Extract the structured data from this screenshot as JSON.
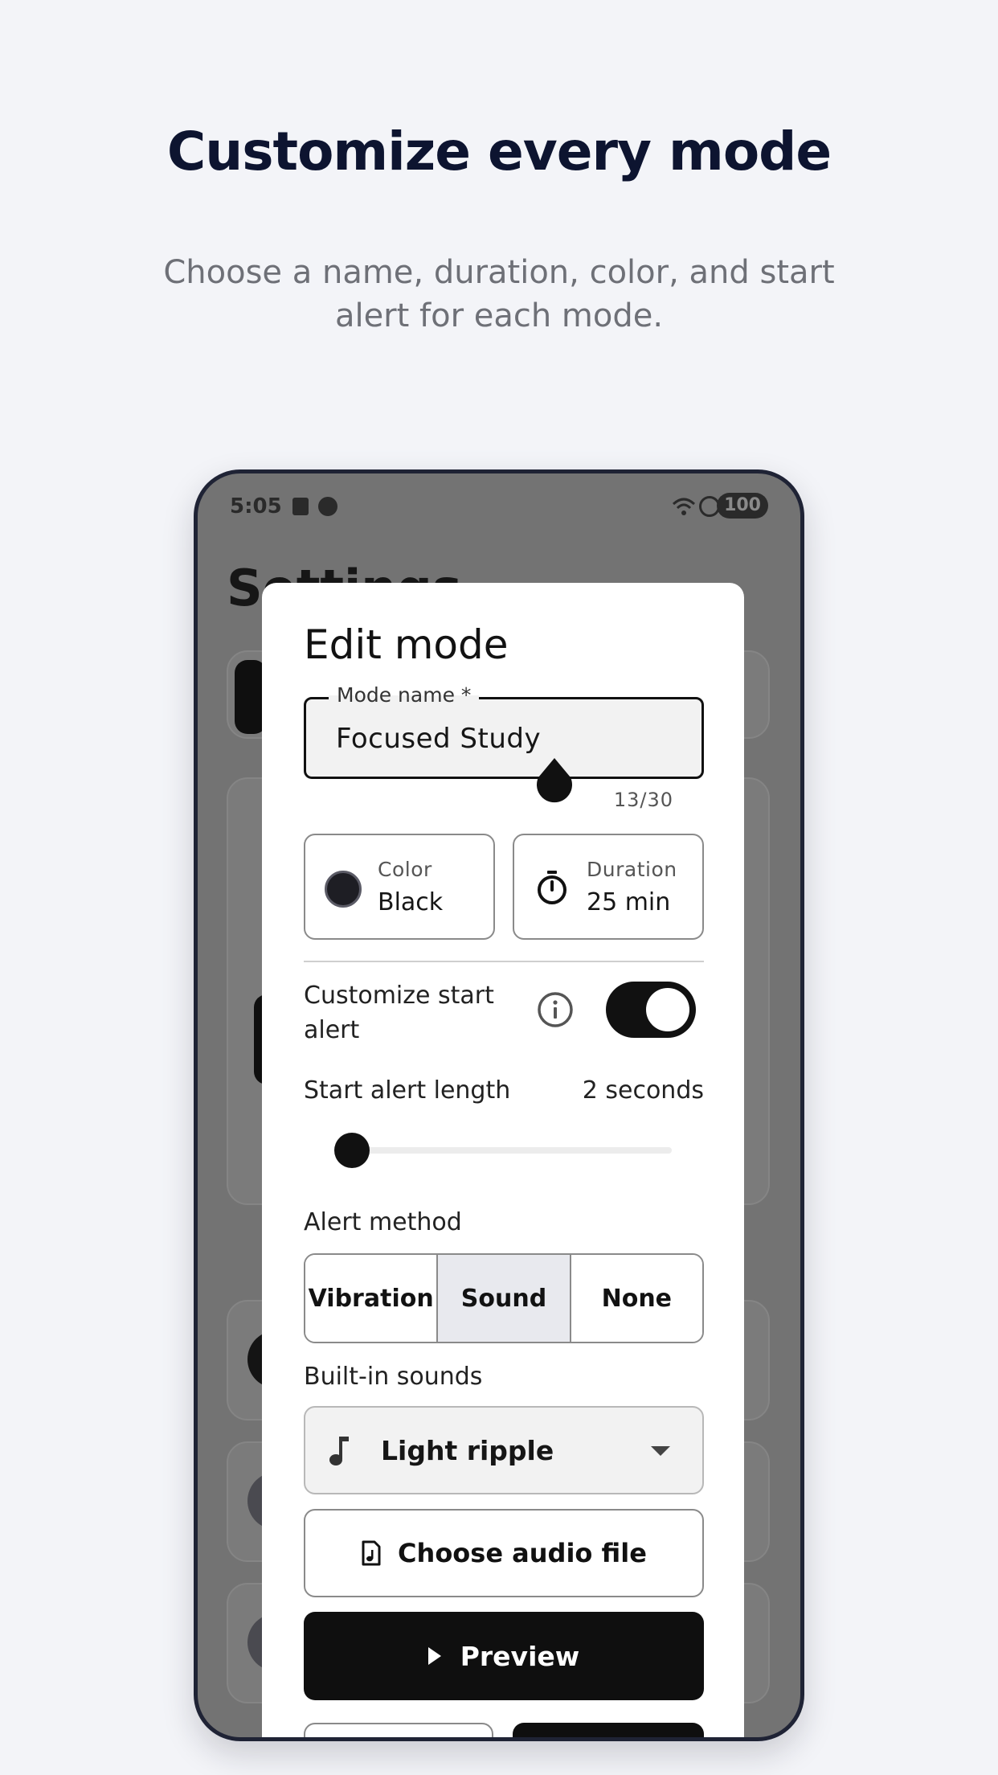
{
  "header": {
    "title": "Customize every mode",
    "subtitle": "Choose a name, duration, color, and start alert for each mode."
  },
  "status_bar": {
    "time": "5:05",
    "battery": "100"
  },
  "background_screen": {
    "title": "Settings"
  },
  "dialog": {
    "title": "Edit mode",
    "mode_name": {
      "label": "Mode name *",
      "value": "Focused Study",
      "counter": "13/30"
    },
    "color": {
      "label": "Color",
      "value": "Black",
      "swatch": "#1e1e24"
    },
    "duration": {
      "label": "Duration",
      "value": "25 min"
    },
    "customize_start_alert": {
      "label": "Customize start alert",
      "enabled": true
    },
    "start_alert_length": {
      "label": "Start alert length",
      "value": "2 seconds"
    },
    "alert_method": {
      "label": "Alert method",
      "options": [
        "Vibration",
        "Sound",
        "None"
      ],
      "selected": "Sound"
    },
    "built_in_sounds": {
      "label": "Built-in sounds",
      "selected": "Light ripple"
    },
    "choose_audio_label": "Choose audio file",
    "preview_label": "Preview"
  },
  "icons": [
    "check-icon",
    "user-icon",
    "wifi-icon",
    "do-not-disturb-icon",
    "timer-icon",
    "info-icon",
    "music-note-icon",
    "audio-file-icon",
    "play-icon",
    "dropdown-caret-icon"
  ]
}
